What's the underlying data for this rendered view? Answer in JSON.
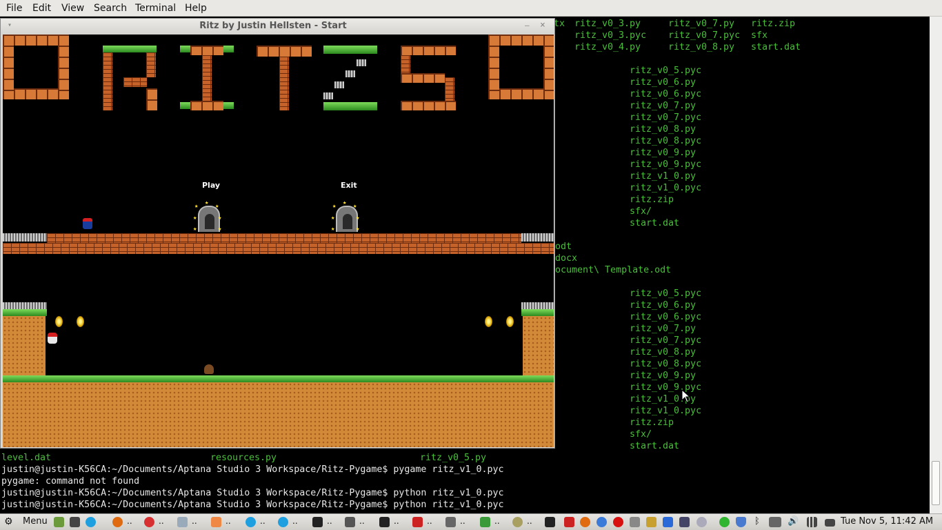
{
  "menubar": {
    "items": [
      "File",
      "Edit",
      "View",
      "Search",
      "Terminal",
      "Help"
    ]
  },
  "terminal": {
    "top_right_rows": [
      {
        "a": "tx",
        "b": "ritz_v0_3.py",
        "c": "ritz_v0_7.py",
        "d": "ritz.zip"
      },
      {
        "a": "",
        "b": "ritz_v0_3.pyc",
        "c": "ritz_v0_7.pyc",
        "d": "sfx"
      },
      {
        "a": "",
        "b": "ritz_v0_4.py",
        "c": "ritz_v0_8.py",
        "d": "start.dat"
      }
    ],
    "listing1": [
      "ritz_v0_5.pyc",
      "ritz_v0_6.py",
      "ritz_v0_6.pyc",
      "ritz_v0_7.py",
      "ritz_v0_7.pyc",
      "ritz_v0_8.py",
      "ritz_v0_8.pyc",
      "ritz_v0_9.py",
      "ritz_v0_9.pyc",
      "ritz_v1_0.py",
      "ritz_v1_0.pyc",
      "ritz.zip",
      "sfx/",
      "start.dat"
    ],
    "partial_lines": [
      "odt",
      "docx",
      "ocument\\ Template.odt"
    ],
    "listing2": [
      "ritz_v0_5.pyc",
      "ritz_v0_6.py",
      "ritz_v0_6.pyc",
      "ritz_v0_7.py",
      "ritz_v0_7.pyc",
      "ritz_v0_8.py",
      "ritz_v0_8.pyc",
      "ritz_v0_9.py",
      "ritz_v0_9.pyc",
      "ritz_v1_0.py",
      "ritz_v1_0.pyc",
      "ritz.zip",
      "sfx/",
      "start.dat"
    ],
    "bottom_files": {
      "a": "level.dat",
      "b": "resources.py",
      "c": "ritz_v0_5.py"
    },
    "prompt_lines": [
      "justin@justin-K56CA:~/Documents/Aptana Studio 3 Workspace/Ritz-Pygame$ pygame ritz_v1_0.pyc",
      "pygame: command not found",
      "justin@justin-K56CA:~/Documents/Aptana Studio 3 Workspace/Ritz-Pygame$ python ritz_v1_0.pyc",
      "justin@justin-K56CA:~/Documents/Aptana Studio 3 Workspace/Ritz-Pygame$ python ritz_v1_0.pyc"
    ]
  },
  "game_window": {
    "title": "Ritz by Justin Hellsten - Start",
    "play_label": "Play",
    "exit_label": "Exit",
    "logo_letters": [
      "R",
      "I",
      "T",
      "Z",
      "S"
    ]
  },
  "taskbar": {
    "menu_label": "Menu",
    "ellipsis": "..",
    "clock": "Tue Nov  5, 11:42 AM",
    "colors": {
      "green": "#4bbf3c",
      "brick": "#c4622a",
      "dirt": "#d28a38"
    }
  }
}
